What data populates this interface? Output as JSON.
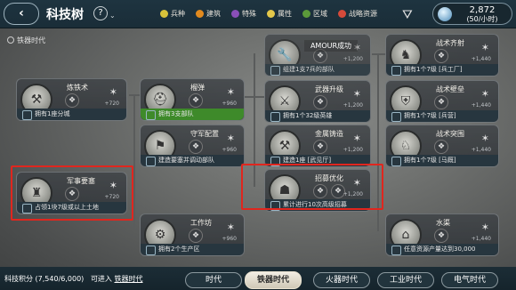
{
  "header": {
    "back_icon": "‹",
    "title": "科技树",
    "help_icon": "?",
    "legend": [
      {
        "label": "兵种",
        "color": "#d8c23a"
      },
      {
        "label": "建筑",
        "color": "#e28a1e"
      },
      {
        "label": "特殊",
        "color": "#8a4fb8"
      },
      {
        "label": "属性",
        "color": "#e4c84a"
      },
      {
        "label": "区域",
        "color": "#5c9a3a"
      },
      {
        "label": "战略资源",
        "color": "#d64a3a"
      }
    ],
    "filter_icon": "filter-icon",
    "resource_value": "2,872",
    "resource_rate": "(50/小时)"
  },
  "era_label": "铁器时代",
  "popup_text": "AMOUR成功",
  "nodes": [
    {
      "name": "炼铁术",
      "reward": "+720",
      "desc": "拥有1座分城"
    },
    {
      "name": "",
      "reward": "+1,200",
      "desc": "组建1支7兵的部队"
    },
    {
      "name": "战术齐射",
      "reward": "+1,440",
      "desc": "拥有1个7级 [兵工厂]"
    },
    {
      "name": "榴弹",
      "reward": "+960",
      "desc": "拥有3支部队"
    },
    {
      "name": "武器升级",
      "reward": "+1,200",
      "desc": "拥有1个32级英雄"
    },
    {
      "name": "战术壁垒",
      "reward": "+1,440",
      "desc": "拥有1个7级 [兵营]"
    },
    {
      "name": "守军配置",
      "reward": "+960",
      "desc": "建造要塞并调动部队"
    },
    {
      "name": "金属铸造",
      "reward": "+1,200",
      "desc": "建造1座 [武见厅]"
    },
    {
      "name": "战术突围",
      "reward": "+1,440",
      "desc": "拥有1个7级 [马厩]"
    },
    {
      "name": "军事要塞",
      "reward": "+720",
      "desc": "占领1块7级或以上土地"
    },
    {
      "name": "招募优化",
      "reward": "+1,200",
      "desc": "累计进行10次高级招募"
    },
    {
      "name": "工作坊",
      "reward": "+960",
      "desc": "拥有2个生产区"
    },
    {
      "name": "水渠",
      "reward": "+1,440",
      "desc": "任意资源产量达到30,000"
    }
  ],
  "footer": {
    "score": "科技积分 (7,540/6,000)",
    "access": "可进入",
    "access_link": "铁器时代",
    "tabs": [
      "时代",
      "铁器时代",
      "火器时代",
      "工业时代",
      "电气时代"
    ]
  }
}
